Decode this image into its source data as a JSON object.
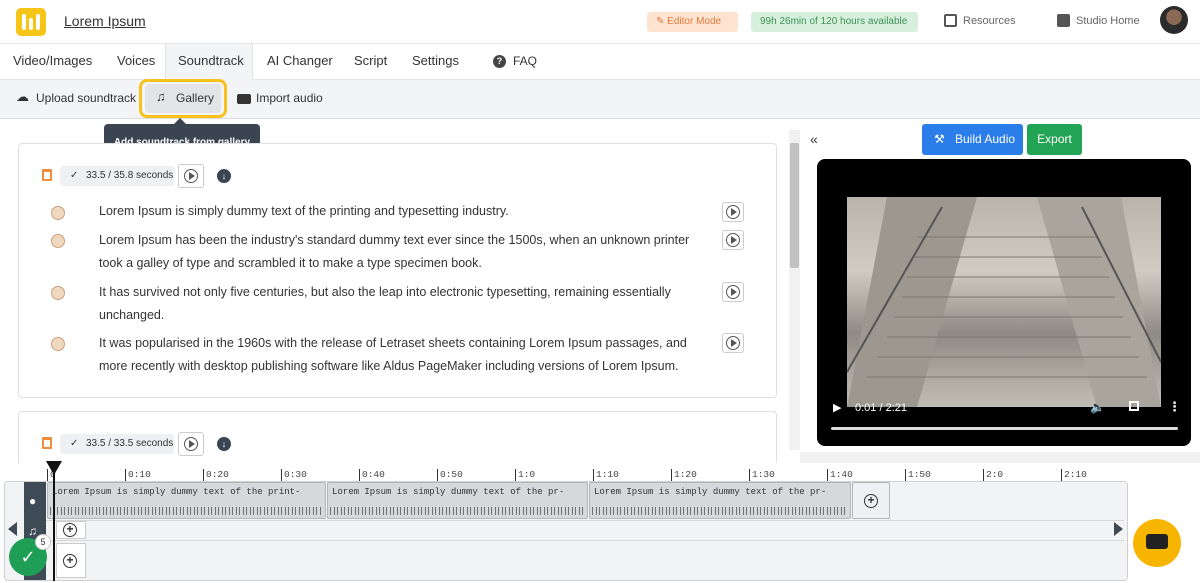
{
  "header": {
    "app_title": "Lorem Ipsum",
    "editor_mode": "Editor Mode",
    "hours_available": "99h 26min of 120 hours available",
    "resources": "Resources",
    "studio_home": "Studio Home"
  },
  "tabs": [
    {
      "label": "Video/Images"
    },
    {
      "label": "Voices"
    },
    {
      "label": "Soundtrack"
    },
    {
      "label": "AI Changer"
    },
    {
      "label": "Script"
    },
    {
      "label": "Settings"
    },
    {
      "label": "FAQ"
    }
  ],
  "toolbar": {
    "upload": "Upload soundtrack",
    "gallery": "Gallery",
    "import": "Import audio",
    "tooltip": "Add soundtrack from gallery"
  },
  "blocks": [
    {
      "duration": "33.5 / 35.8 seconds",
      "lines": [
        "Lorem Ipsum is simply dummy text of the printing and typesetting industry.",
        "Lorem Ipsum has been the industry's standard dummy text ever since the 1500s, when an unknown printer took a galley of type and scrambled it to make a type specimen book.",
        "It has survived not only five centuries, but also the leap into electronic typesetting, remaining essentially unchanged.",
        "It was popularised in the 1960s with the release of Letraset sheets containing Lorem Ipsum passages, and more recently with desktop publishing software like Aldus PageMaker including versions of Lorem Ipsum."
      ]
    },
    {
      "duration": "33.5 / 33.5 seconds"
    }
  ],
  "right": {
    "build_audio": "Build Audio",
    "export": "Export",
    "video_time": "0:01 / 2:21"
  },
  "timeline": {
    "ticks": [
      "0",
      "0:10",
      "0:20",
      "0:30",
      "0:40",
      "0:50",
      "1:0",
      "1:10",
      "1:20",
      "1:30",
      "1:40",
      "1:50",
      "2:0",
      "2:10"
    ],
    "clips": [
      "Lorem Ipsum is simply dummy text of the print-",
      "Lorem Ipsum is simply dummy text of the pr-",
      "Lorem Ipsum is simply dummy text of the pr-"
    ],
    "badge_count": "5"
  }
}
